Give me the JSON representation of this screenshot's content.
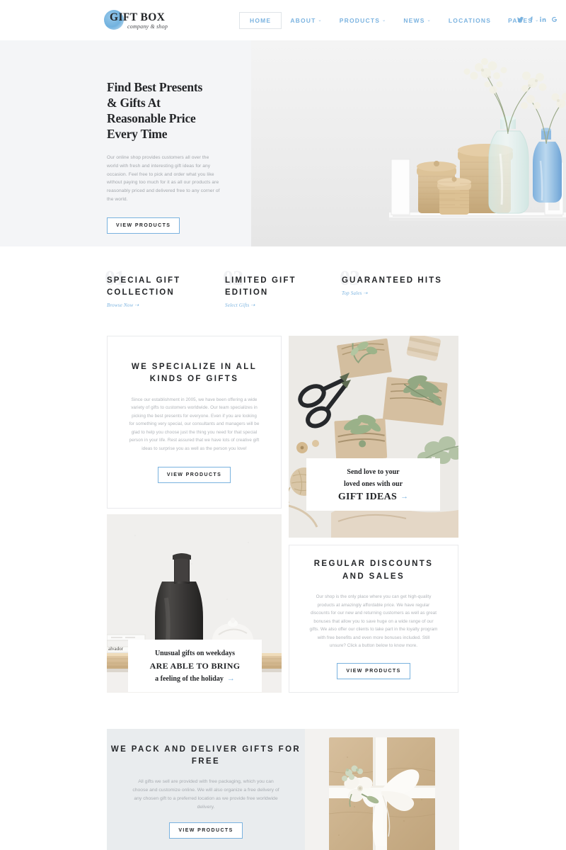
{
  "header": {
    "logo": {
      "main": "GIFT BOX",
      "sub": "company & shop"
    },
    "nav": [
      {
        "label": "HOME",
        "caret": "",
        "active": true
      },
      {
        "label": "ABOUT",
        "caret": "⌄",
        "active": false
      },
      {
        "label": "PRODUCTS",
        "caret": "⌄",
        "active": false
      },
      {
        "label": "NEWS",
        "caret": "⌄",
        "active": false
      },
      {
        "label": "LOCATIONS",
        "caret": "",
        "active": false
      },
      {
        "label": "PAGES",
        "caret": "⌄",
        "active": false
      }
    ],
    "social": [
      {
        "name": "twitter-icon",
        "glyph": "🐦"
      },
      {
        "name": "facebook-icon",
        "glyph": "f"
      },
      {
        "name": "linkedin-icon",
        "glyph": "in"
      },
      {
        "name": "google-icon",
        "glyph": "G"
      }
    ]
  },
  "hero": {
    "title": "Find Best Presents\n& Gifts At\nReasonable Price\nEvery Time",
    "title_lines": [
      "Find Best Presents",
      "& Gifts At",
      "Reasonable Price",
      "Every Time"
    ],
    "text": "Our online shop provides customers all over the world with fresh and interesting gift ideas for any occasion. Feel free to pick and order what you like without paying too much for it as all our products are reasonably priced and delivered free to any corner of the world.",
    "button": "VIEW PRODUCTS",
    "image_alt": "wicker-baskets-and-glass-vases-photo"
  },
  "features": [
    {
      "number": "01",
      "title": "SPECIAL GIFT COLLECTION",
      "link": "Browse Now ⇢"
    },
    {
      "number": "02",
      "title": "LIMITED GIFT EDITION",
      "link": "Select Gifts ⇢"
    },
    {
      "number": "03",
      "title": "GUARANTEED HITS",
      "link": "Top Sales ⇢"
    }
  ],
  "cards": {
    "specialize": {
      "title": "WE SPECIALIZE IN ALL KINDS OF GIFTS",
      "text": "Since our establishment in 2005, we have been offering a wide variety of gifts to customers worldwide. Our team specializes in picking the best presents for everyone. Even if you are looking for something very special, our consultants and managers will be glad to help you choose just the thing you need for that special person in your life. Rest assured that we have lots of creative gift ideas to surprise you as well as the person you love!",
      "button": "VIEW PRODUCTS"
    },
    "discounts": {
      "title": "REGULAR DISCOUNTS AND SALES",
      "text": "Our shop is the only place where you can get high-quality products at amazingly affordable price. We have regular discounts for our new and returning customers as well as great bonuses that allow you to save huge on a wide range of our gifts. We also offer our clients to take part in the loyalty program with free benefits and even more bonuses included. Still unsure? Click a button below to know more.",
      "button": "VIEW PRODUCTS"
    }
  },
  "overlays": {
    "gift_ideas": {
      "line1": "Send love to your",
      "line2": "loved ones with our",
      "emphasis": "GIFT IDEAS",
      "arrow": "→"
    },
    "weekdays": {
      "line1": "Unusual gifts on weekdays",
      "emphasis": "ARE ABLE TO BRING",
      "line3": "a feeling of the holiday",
      "arrow": "→"
    }
  },
  "photos": {
    "scissors_gifts": "scissors-and-wrapped-gifts-photo",
    "black_vase": "black-vase-on-shelf-photo",
    "gift_box_ribbon": "kraft-gift-box-with-white-ribbon-photo"
  },
  "banner": {
    "title": "WE PACK AND DELIVER GIFTS FOR FREE",
    "text": "All gifts we sell are provided with free packaging, which you can choose and customize online. We will also organize a free delivery of any chosen gift to a preferred location as we provide free worldwide delivery.",
    "button": "VIEW PRODUCTS"
  },
  "colors": {
    "accent": "#79b2df",
    "text_dark": "#232528",
    "text_muted": "#b0b4b9",
    "hero_bg": "#f4f5f7",
    "banner_bg": "#e9ecee"
  }
}
